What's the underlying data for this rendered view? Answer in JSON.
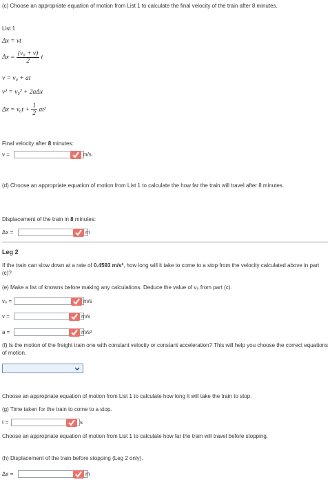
{
  "part_c": {
    "prompt": "(c) Choose an appropriate equation of motion from List 1 to calculate the final velocity of the train after 8 minutes.",
    "list_label": "List 1",
    "equations": {
      "eq1": "Δx = vt",
      "eq2_lhs": "Δx =",
      "eq2_num": "(v₀ + v)",
      "eq2_den": "2",
      "eq2_tail": "t",
      "eq3": "v = v₀ + at",
      "eq4": "v² = v₀² + 2aΔx",
      "eq5_lhs": "Δx = v₀t +",
      "eq5_num": "1",
      "eq5_den": "2",
      "eq5_tail": "at²"
    },
    "answer_label_prefix": "Final velocity after ",
    "answer_label_bold": "8",
    "answer_label_suffix": " minutes:",
    "var": "v =",
    "unit": "m/s",
    "value": ""
  },
  "part_d": {
    "prompt": "(d) Choose an appropriate equation of motion from List 1 to calculate the how far the train will travel after 8 minutes.",
    "answer_label_prefix": "Displacement of the train in ",
    "answer_label_bold": "8",
    "answer_label_suffix": " minutes:",
    "var": "Δx =",
    "unit": "m",
    "value": ""
  },
  "leg2": {
    "heading": "Leg 2",
    "intro_prefix": "If the train can slow down at a rate of ",
    "intro_bold": "0.4593 m/s²",
    "intro_suffix": ", how long will it take to come to a stop from the velocity calculated above in part (c)?",
    "part_e": {
      "prompt": "(e) Make a list of knowns before making any calculations. Deduce the value of v₀ from part (c).",
      "rows": [
        {
          "var": "v₀ =",
          "unit": "m/s",
          "value": ""
        },
        {
          "var": "v =",
          "unit": "m/s",
          "value": ""
        },
        {
          "var": "a =",
          "unit": "m/s²",
          "value": ""
        }
      ]
    },
    "part_f": {
      "prompt": "(f) Is the motion of the freight train one with constant velocity or constant acceleration? This will help you choose the correct equations of motion.",
      "selected": ""
    },
    "part_g": {
      "instruction": "Choose an appropriate equation of motion from List 1 to calculate how long it will take the train to stop.",
      "prompt": "(g) Time taken for the train to come to a stop.",
      "var": "t =",
      "unit": "s",
      "value": ""
    },
    "part_h": {
      "instruction": "Choose an appropriate equation of motion from List 1 to calculate how far the train will travel before stopping.",
      "prompt": "(h) Displacement of the train before stopping (Leg 2 only).",
      "var": "Δx =",
      "unit": "m",
      "value": ""
    }
  },
  "colors": {
    "check_bg": "#e8736b",
    "select_border": "#6f8fb6",
    "select_bg": "#e9f1fb"
  },
  "icons": {
    "check": "checkmark-icon",
    "dropdown": "chevron-down-icon"
  }
}
